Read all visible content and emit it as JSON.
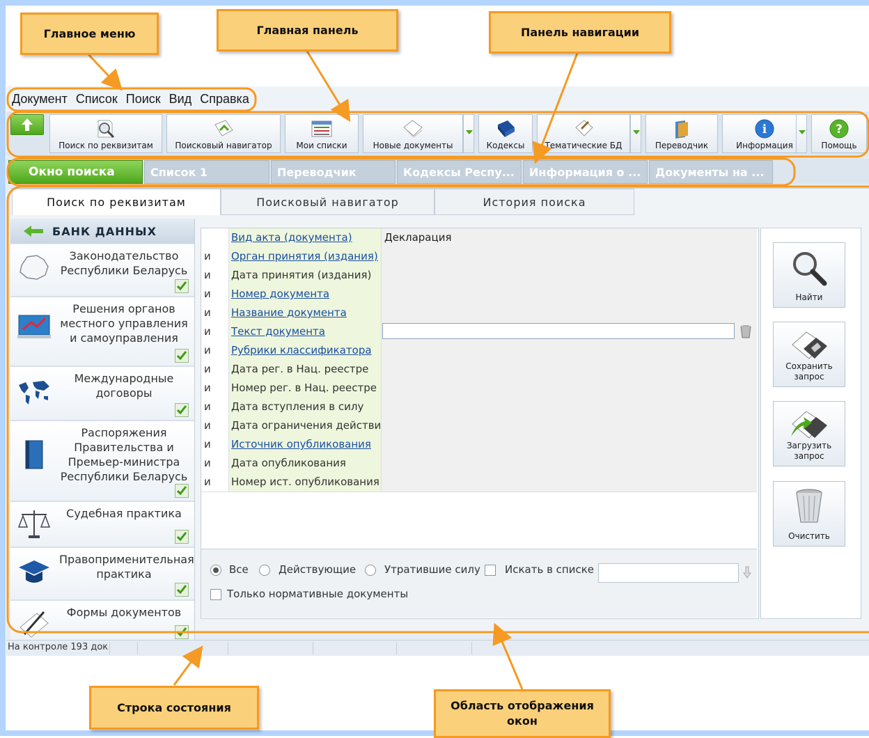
{
  "callouts": {
    "main_menu": "Главное меню",
    "main_panel": "Главная панель",
    "nav_panel": "Панель навигации",
    "status_bar": "Строка состояния",
    "display_area_line1": "Область отображения",
    "display_area_line2": "окон"
  },
  "menu": [
    "Документ",
    "Список",
    "Поиск",
    "Вид",
    "Справка"
  ],
  "toolbar": {
    "buttons": [
      {
        "label": "Поиск по реквизитам",
        "icon": "search-details-icon"
      },
      {
        "label": "Поисковый навигатор",
        "icon": "search-navigator-icon"
      },
      {
        "label": "Мои списки",
        "icon": "my-lists-icon"
      },
      {
        "label": "Новые документы",
        "icon": "new-documents-icon"
      },
      {
        "label": "Кодексы",
        "icon": "codes-book-icon"
      },
      {
        "label": "Тематические БД",
        "icon": "thematic-db-icon"
      },
      {
        "label": "Переводчик",
        "icon": "translator-icon"
      },
      {
        "label": "Информация",
        "icon": "info-icon"
      },
      {
        "label": "Помощь",
        "icon": "help-icon"
      }
    ]
  },
  "window_tabs": [
    "Окно поиска",
    "Список 1",
    "Переводчик",
    "Кодексы Респу...",
    "Информация о ...",
    "Документы на ..."
  ],
  "sub_tabs": [
    "Поиск по реквизитам",
    "Поисковый навигатор",
    "История поиска"
  ],
  "sidebar": {
    "title": "БАНК ДАННЫХ",
    "items": [
      {
        "label": "Законодательство Республики Беларусь",
        "icon": "belarus-map-icon",
        "checked": true
      },
      {
        "label": "Решения органов местного управления и самоуправления",
        "icon": "easel-icon",
        "checked": true
      },
      {
        "label": "Международные договоры",
        "icon": "world-map-icon",
        "checked": true
      },
      {
        "label": "Распоряжения Правительства и Премьер-министра Республики Беларусь",
        "icon": "book-icon",
        "checked": true
      },
      {
        "label": "Судебная практика",
        "icon": "scales-icon",
        "checked": true
      },
      {
        "label": "Правоприменительная практика",
        "icon": "graduation-cap-icon",
        "checked": true
      },
      {
        "label": "Формы документов",
        "icon": "pen-paper-icon",
        "checked": true
      }
    ]
  },
  "fields": [
    {
      "op": "",
      "name": "Вид акта (документа)",
      "link": true,
      "value": "Декларация"
    },
    {
      "op": "и",
      "name": "Орган принятия (издания)",
      "link": true,
      "value": ""
    },
    {
      "op": "и",
      "name": "Дата принятия (издания)",
      "link": false,
      "value": ""
    },
    {
      "op": "и",
      "name": "Номер документа",
      "link": true,
      "value": ""
    },
    {
      "op": "и",
      "name": "Название документа",
      "link": true,
      "value": ""
    },
    {
      "op": "и",
      "name": "Текст документа",
      "link": true,
      "value": ""
    },
    {
      "op": "и",
      "name": "Рубрики классификатора",
      "link": true,
      "value": ""
    },
    {
      "op": "и",
      "name": "Дата рег. в Нац. реестре",
      "link": false,
      "value": ""
    },
    {
      "op": "и",
      "name": "Номер рег. в Нац. реестре",
      "link": false,
      "value": ""
    },
    {
      "op": "и",
      "name": "Дата вступления в силу",
      "link": false,
      "value": ""
    },
    {
      "op": "и",
      "name": "Дата ограничения действия",
      "link": false,
      "value": ""
    },
    {
      "op": "и",
      "name": "Источник опубликования",
      "link": true,
      "value": ""
    },
    {
      "op": "и",
      "name": "Дата опубликования",
      "link": false,
      "value": ""
    },
    {
      "op": "и",
      "name": "Номер ист. опубликования",
      "link": false,
      "value": ""
    }
  ],
  "filters": {
    "all": "Все",
    "active": "Действующие",
    "expired": "Утратившие силу",
    "search_in_list": "Искать в списке",
    "normative_only": "Только нормативные документы"
  },
  "actions": [
    {
      "label": "Найти",
      "icon": "magnifier-icon"
    },
    {
      "label": "Сохранить запрос",
      "icon": "save-disk-icon"
    },
    {
      "label": "Загрузить запрос",
      "icon": "load-disk-icon"
    },
    {
      "label": "Очистить",
      "icon": "trash-icon"
    }
  ],
  "status": {
    "text": "На контроле 193 док"
  },
  "colors": {
    "callout_fill": "#fbd07a",
    "callout_border": "#f59a23",
    "accent_green": "#4ea71c",
    "link": "#1a4fa0"
  }
}
